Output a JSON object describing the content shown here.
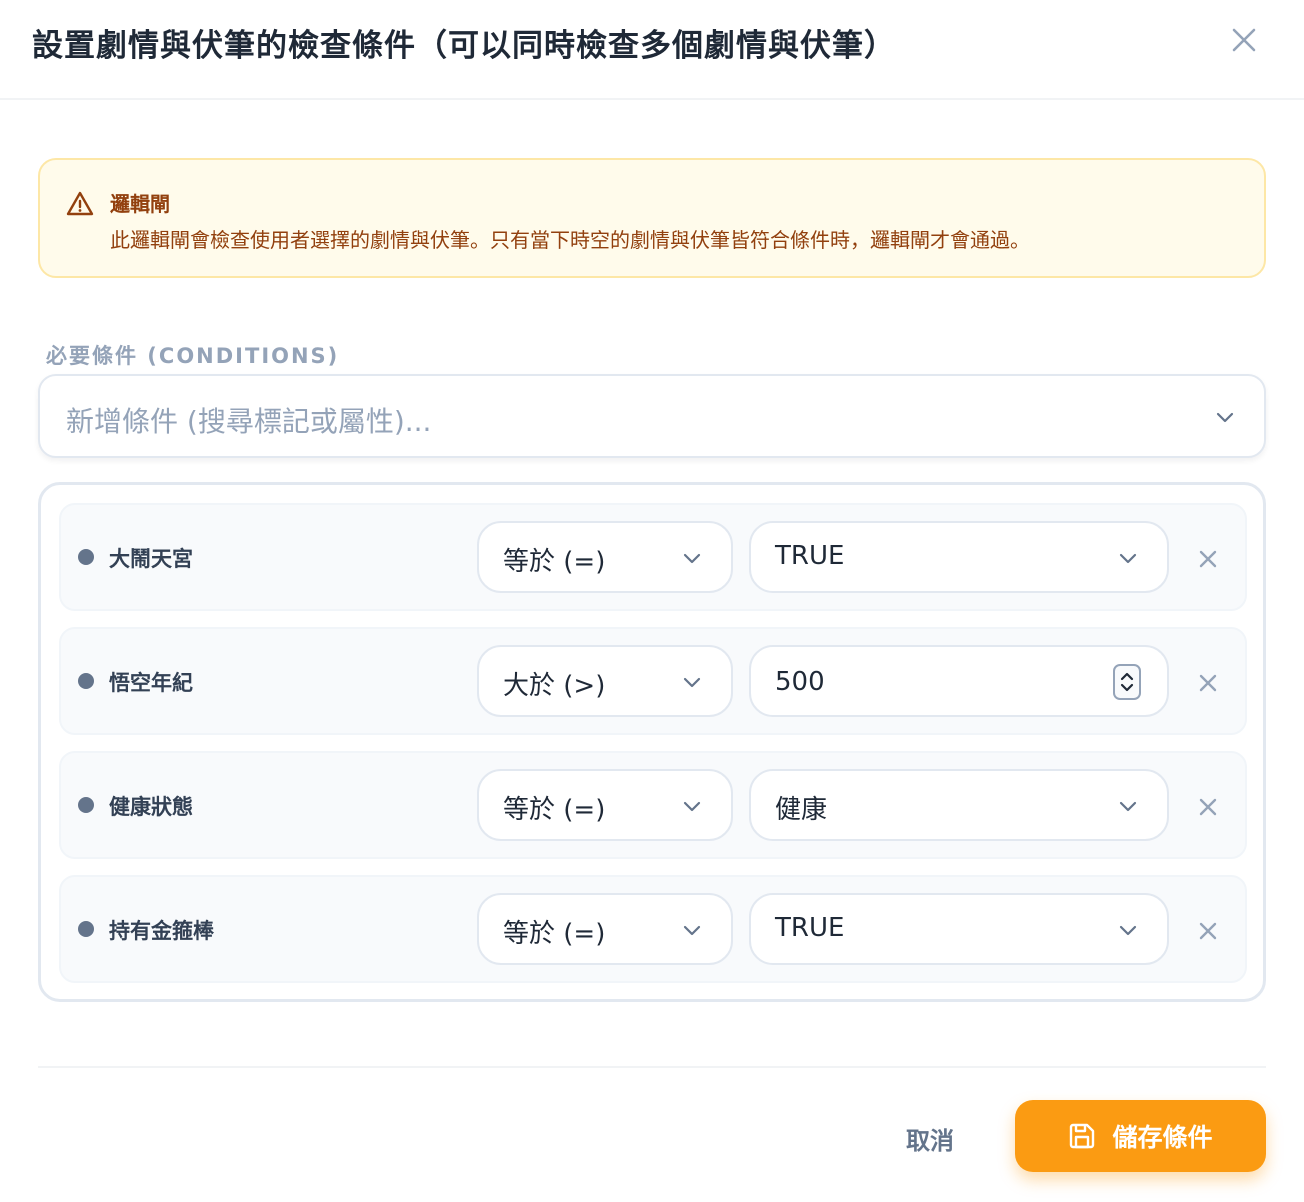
{
  "dialog": {
    "title": "設置劇情與伏筆的檢查條件（可以同時檢查多個劇情與伏筆）"
  },
  "alert": {
    "title": "邏輯閘",
    "text": "此邏輯閘會檢查使用者選擇的劇情與伏筆。只有當下時空的劇情與伏筆皆符合條件時，邏輯閘才會通過。"
  },
  "conditions": {
    "section_label": "必要條件 (CONDITIONS)",
    "add_placeholder": "新增條件 (搜尋標記或屬性)...",
    "rows": [
      {
        "name": "大鬧天宮",
        "operator": "等於 (=)",
        "value": "TRUE"
      },
      {
        "name": "悟空年紀",
        "operator": "大於 (>)",
        "value": "500"
      },
      {
        "name": "健康狀態",
        "operator": "等於 (=)",
        "value": "健康"
      },
      {
        "name": "持有金箍棒",
        "operator": "等於 (=)",
        "value": "TRUE"
      }
    ]
  },
  "footer": {
    "cancel_label": "取消",
    "save_label": "儲存條件"
  },
  "colors": {
    "accent": "#fb9b12",
    "alert_bg": "#fffbeb",
    "alert_text": "#92400e"
  }
}
